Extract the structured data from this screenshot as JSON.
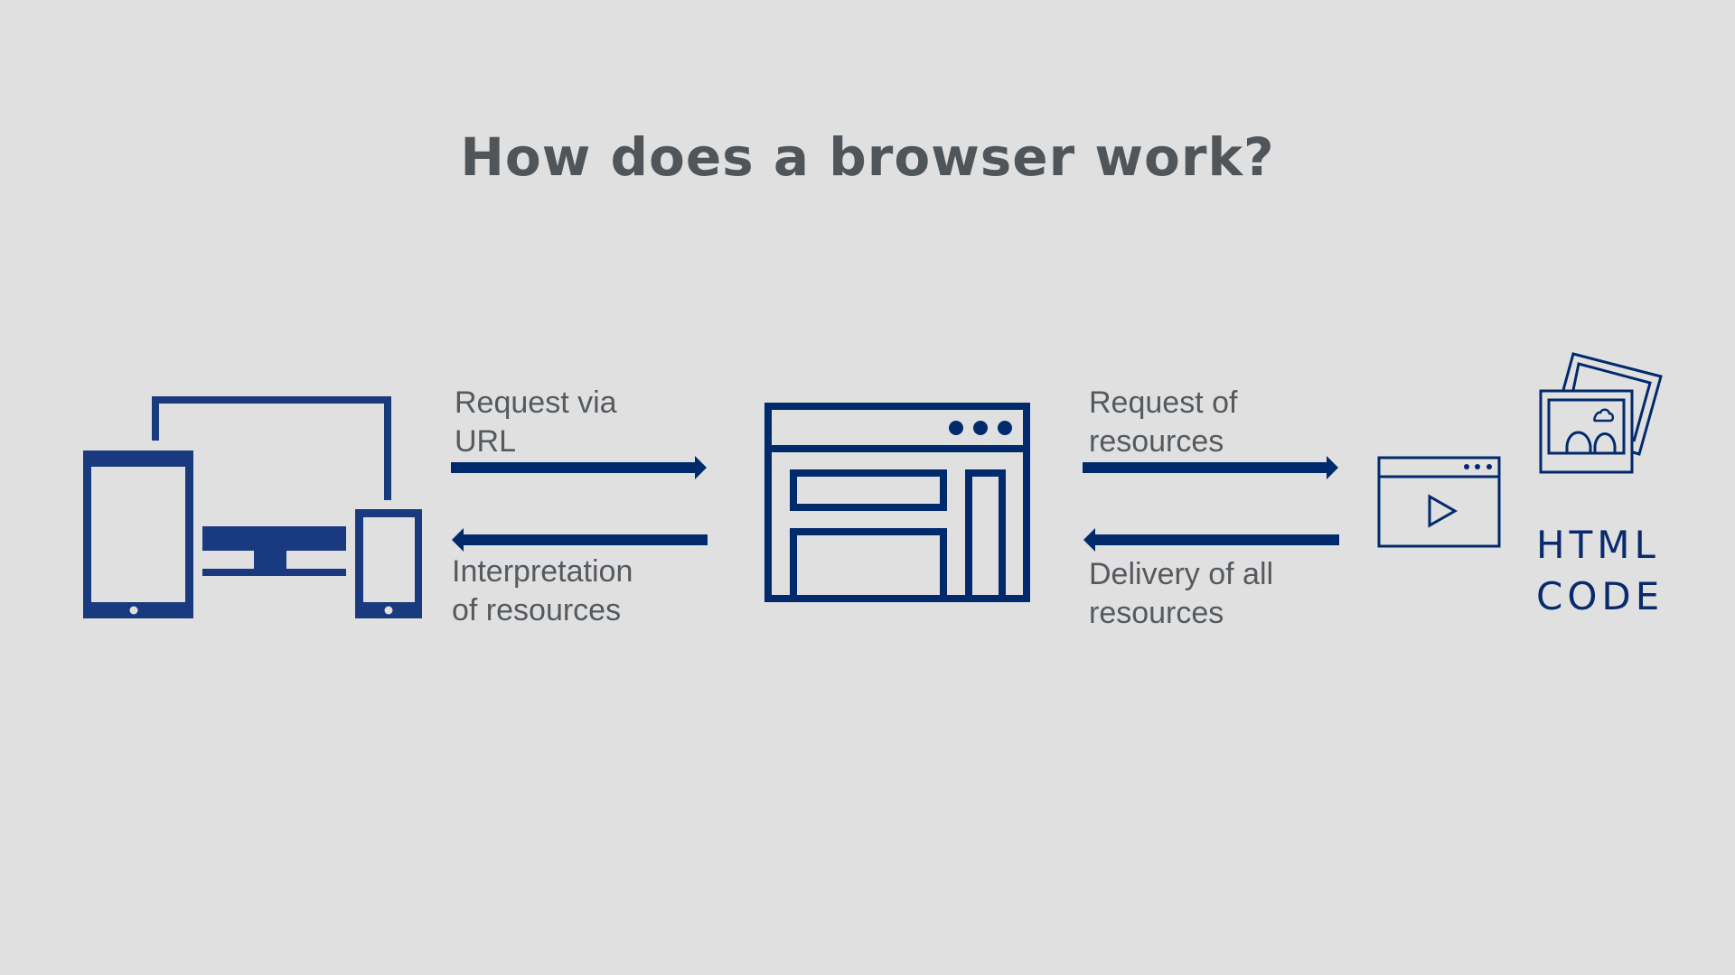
{
  "title": "How does a browser work?",
  "labels": {
    "request_url": [
      "Request via",
      "URL"
    ],
    "interpretation": [
      "Interpretation",
      "of resources"
    ],
    "request_resources": [
      "Request of",
      "resources"
    ],
    "delivery": [
      "Delivery of all",
      "resources"
    ]
  },
  "html_code": [
    "HTML",
    "CODE"
  ],
  "nodes": [
    {
      "id": "devices",
      "icon": "devices-icon"
    },
    {
      "id": "browser",
      "icon": "browser-window-icon"
    },
    {
      "id": "resources",
      "icon": "video-window-icon"
    },
    {
      "id": "images",
      "icon": "images-icon"
    }
  ],
  "edges": [
    {
      "from": "devices",
      "to": "browser",
      "label": "Request via URL"
    },
    {
      "from": "browser",
      "to": "devices",
      "label": "Interpretation of resources"
    },
    {
      "from": "browser",
      "to": "resources",
      "label": "Request of resources"
    },
    {
      "from": "resources",
      "to": "browser",
      "label": "Delivery of all resources"
    }
  ],
  "colors": {
    "background": "#e0e0e0",
    "navy": "#002a6c",
    "device_blue": "#1a3a80",
    "text": "#555a5f"
  }
}
